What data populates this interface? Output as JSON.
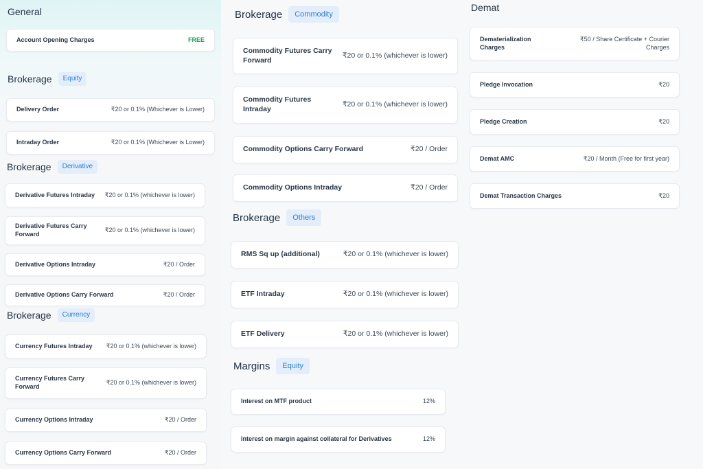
{
  "general": {
    "title": "General",
    "rows": [
      {
        "label": "Account Opening Charges",
        "value": "FREE"
      }
    ]
  },
  "brokerage_equity": {
    "title": "Brokerage",
    "badge": "Equity",
    "rows": [
      {
        "label": "Delivery Order",
        "value": "₹20 or 0.1% (Whichever is Lower)"
      },
      {
        "label": "Intraday Order",
        "value": "₹20 or 0.1% (Whichever is Lower)"
      }
    ]
  },
  "brokerage_derivative": {
    "title": "Brokerage",
    "badge": "Derivative",
    "rows": [
      {
        "label": "Derivative Futures Intraday",
        "value": "₹20 or 0.1% (whichever is lower)"
      },
      {
        "label": "Derivative Futures Carry Forward",
        "value": "₹20 or 0.1% (whichever is lower)"
      },
      {
        "label": "Derivative Options Intraday",
        "value": "₹20 / Order"
      },
      {
        "label": "Derivative Options Carry Forward",
        "value": "₹20 / Order"
      }
    ]
  },
  "brokerage_currency": {
    "title": "Brokerage",
    "badge": "Currency",
    "rows": [
      {
        "label": "Currency Futures Intraday",
        "value": "₹20 or 0.1% (whichever is lower)"
      },
      {
        "label": "Currency Futures Carry Forward",
        "value": "₹20 or 0.1% (whichever is lower)"
      },
      {
        "label": "Currency Options Intraday",
        "value": "₹20 / Order"
      },
      {
        "label": "Currency Options Carry Forward",
        "value": "₹20 / Order"
      }
    ]
  },
  "brokerage_commodity": {
    "title": "Brokerage",
    "badge": "Commodity",
    "rows": [
      {
        "label": "Commodity Futures Carry Forward",
        "value": "₹20 or 0.1% (whichever is lower)"
      },
      {
        "label": "Commodity Futures Intraday",
        "value": "₹20 or 0.1% (whichever is lower)"
      },
      {
        "label": "Commodity Options Carry Forward",
        "value": "₹20 / Order"
      },
      {
        "label": "Commodity Options Intraday",
        "value": "₹20 / Order"
      }
    ]
  },
  "brokerage_others": {
    "title": "Brokerage",
    "badge": "Others",
    "rows": [
      {
        "label": "RMS Sq up (additional)",
        "value": "₹20 or 0.1% (whichever is lower)"
      },
      {
        "label": "ETF Intraday",
        "value": "₹20 or 0.1% (whichever is lower)"
      },
      {
        "label": "ETF Delivery",
        "value": "₹20 or 0.1% (whichever is lower)"
      }
    ]
  },
  "margins_equity": {
    "title": "Margins",
    "badge": "Equity",
    "rows": [
      {
        "label": "Interest on MTF product",
        "value": "12%"
      },
      {
        "label": "Interest on margin against collateral for Derivatives",
        "value": "12%"
      }
    ]
  },
  "demat": {
    "title": "Demat",
    "rows": [
      {
        "label": "Dematerialization Charges",
        "value": "₹50 / Share Certificate + Courier Charges"
      },
      {
        "label": "Pledge Invocation",
        "value": "₹20"
      },
      {
        "label": "Pledge Creation",
        "value": "₹20"
      },
      {
        "label": "Demat AMC",
        "value": "₹20 / Month (Free for first year)"
      },
      {
        "label": "Demat Transaction Charges",
        "value": "₹20"
      }
    ]
  }
}
